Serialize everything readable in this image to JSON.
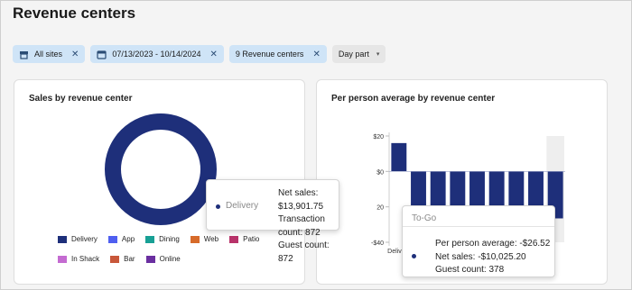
{
  "page": {
    "title": "Revenue centers"
  },
  "filters": {
    "sites": "All sites",
    "date_range": "07/13/2023 - 10/14/2024",
    "revenue_centers": "9 Revenue centers",
    "day_part": "Day part"
  },
  "sales_card": {
    "title": "Sales by revenue center",
    "legend": [
      {
        "label": "Delivery",
        "color": "#1e2f7a"
      },
      {
        "label": "App",
        "color": "#4f5ff0"
      },
      {
        "label": "Dining",
        "color": "#18a095"
      },
      {
        "label": "Web",
        "color": "#d76b2a"
      },
      {
        "label": "Patio",
        "color": "#b8336a"
      },
      {
        "label": "In Shack",
        "color": "#c46bd1"
      },
      {
        "label": "Bar",
        "color": "#c8573a"
      },
      {
        "label": "Online",
        "color": "#6a2fa0"
      }
    ],
    "tooltip": {
      "category": "Delivery",
      "net_sales": "Net sales: $13,901.75",
      "transaction_count": "Transaction count: 872",
      "guest_count": "Guest count: 872"
    }
  },
  "avg_card": {
    "title": "Per person average by revenue center",
    "tooltip": {
      "category": "To-Go",
      "per_person_average": "Per person average: -$26.52",
      "net_sales": "Net sales: -$10,025.20",
      "guest_count": "Guest count: 378"
    }
  },
  "chart_data": [
    {
      "type": "pie",
      "title": "Sales by revenue center",
      "categories": [
        "Delivery",
        "App",
        "Dining",
        "Web",
        "Patio",
        "In Shack",
        "Bar",
        "Online"
      ],
      "values": [
        13901.75,
        0,
        0,
        0,
        0,
        0,
        0,
        0
      ],
      "colors": [
        "#1e2f7a",
        "#4f5ff0",
        "#18a095",
        "#d76b2a",
        "#b8336a",
        "#c46bd1",
        "#c8573a",
        "#6a2fa0"
      ]
    },
    {
      "type": "bar",
      "title": "Per person average by revenue center",
      "categories": [
        "Delivery",
        "",
        "",
        "",
        "",
        "",
        "",
        "",
        "To-Go"
      ],
      "y_tick_labels": [
        "$20",
        "$0",
        "20",
        "-$40"
      ],
      "y_tick_values": [
        20,
        0,
        -20,
        -40
      ],
      "ylim": [
        -40,
        20
      ],
      "values": [
        16,
        -26,
        -26,
        -26,
        -26,
        -26,
        -26,
        -26,
        -26.52
      ],
      "colors": [
        "#1e2f7a",
        "#1e2f7a",
        "#1e2f7a",
        "#1e2f7a",
        "#1e2f7a",
        "#1e2f7a",
        "#1e2f7a",
        "#1e2f7a",
        "#1e2f7a"
      ],
      "highlight_index": 8
    }
  ]
}
